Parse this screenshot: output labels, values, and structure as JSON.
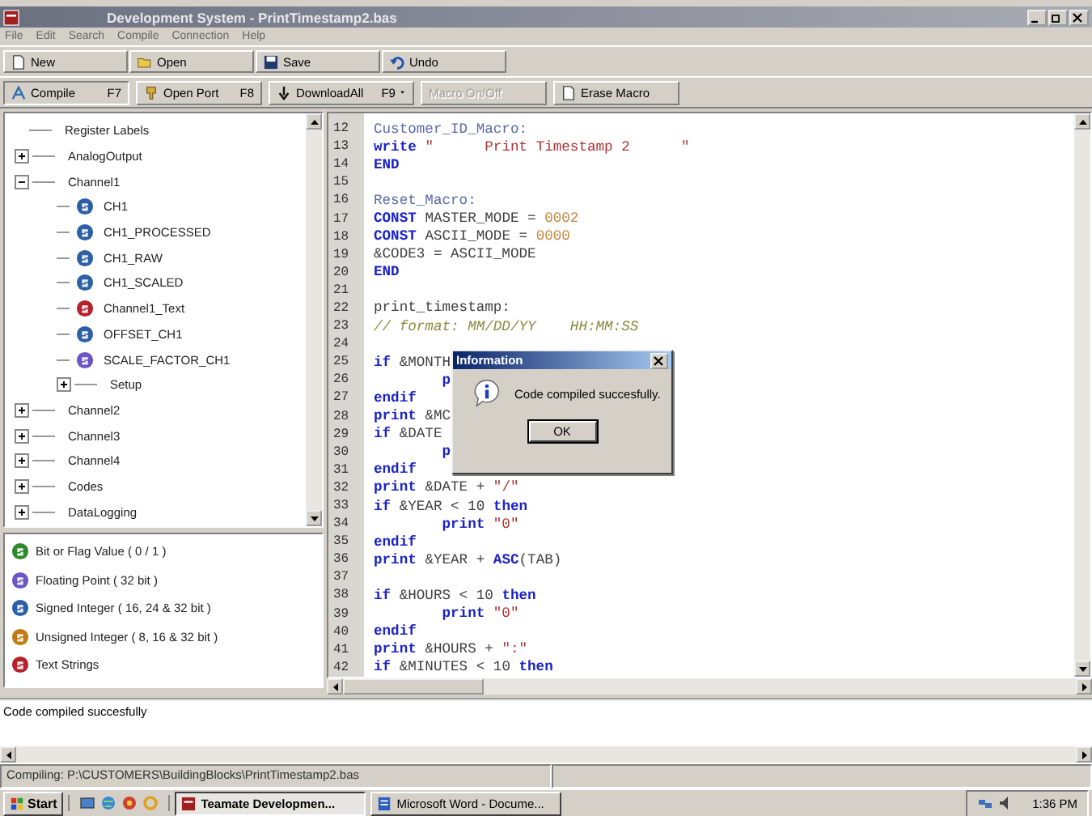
{
  "window": {
    "title": "Development System - PrintTimestamp2.bas"
  },
  "menu": [
    "File",
    "Edit",
    "Search",
    "Compile",
    "Connection",
    "Help"
  ],
  "toolbar": [
    {
      "label": "New",
      "kind": "new"
    },
    {
      "label": "Open",
      "kind": "open"
    },
    {
      "label": "Save",
      "kind": "save"
    },
    {
      "label": "Undo",
      "kind": "undo"
    }
  ],
  "toolbar2": [
    {
      "label": "Compile",
      "shortcut": "F7",
      "kind": "compile",
      "disabled": false,
      "dropdown": false
    },
    {
      "label": "Open Port",
      "shortcut": "F8",
      "kind": "port",
      "disabled": false,
      "dropdown": false
    },
    {
      "label": "DownloadAll",
      "shortcut": "F9",
      "kind": "download",
      "disabled": false,
      "dropdown": true
    },
    {
      "label": "Macro On/Off",
      "kind": "macro",
      "disabled": true,
      "dropdown": false
    },
    {
      "label": "Erase Macro",
      "kind": "erase",
      "disabled": false,
      "dropdown": false
    }
  ],
  "tree": [
    {
      "label": "Register Labels"
    },
    {
      "label": "AnalogOutput",
      "expanded": false
    },
    {
      "label": "Channel1",
      "expanded": true,
      "children": [
        {
          "label": "CH1",
          "kind": "signed"
        },
        {
          "label": "CH1_PROCESSED",
          "kind": "signed"
        },
        {
          "label": "CH1_RAW",
          "kind": "signed"
        },
        {
          "label": "CH1_SCALED",
          "kind": "signed"
        },
        {
          "label": "Channel1_Text",
          "kind": "text"
        },
        {
          "label": "OFFSET_CH1",
          "kind": "signed"
        },
        {
          "label": "SCALE_FACTOR_CH1",
          "kind": "float"
        },
        {
          "label": "Setup",
          "expanded": false
        }
      ]
    },
    {
      "label": "Channel2",
      "expanded": false
    },
    {
      "label": "Channel3",
      "expanded": false
    },
    {
      "label": "Channel4",
      "expanded": false
    },
    {
      "label": "Codes",
      "expanded": false
    },
    {
      "label": "DataLogging",
      "expanded": false
    }
  ],
  "legend": [
    {
      "label": "Bit or Flag Value ( 0 / 1 )",
      "kind": "bit"
    },
    {
      "label": "Floating Point ( 32 bit )",
      "kind": "float"
    },
    {
      "label": "Signed Integer ( 16, 24 & 32 bit )",
      "kind": "signed"
    },
    {
      "label": "Unsigned Integer ( 8, 16 & 32 bit )",
      "kind": "unsigned"
    },
    {
      "label": "Text Strings",
      "kind": "text"
    }
  ],
  "editor": {
    "lines": [
      {
        "number": "12",
        "segments": [
          {
            "text": "Customer_ID_Macro:",
            "kind": "label"
          }
        ]
      },
      {
        "number": "13",
        "segments": [
          {
            "text": "write ",
            "kind": "keyword"
          },
          {
            "text": "\"      Print Timestamp 2      \"",
            "kind": "string"
          }
        ]
      },
      {
        "number": "14",
        "segments": [
          {
            "text": "END",
            "kind": "keyword"
          }
        ]
      },
      {
        "number": "15"
      },
      {
        "number": "16",
        "segments": [
          {
            "text": "Reset_Macro:",
            "kind": "label"
          }
        ]
      },
      {
        "number": "17",
        "segments": [
          {
            "text": "CONST ",
            "kind": "keyword"
          },
          {
            "text": "MASTER_MODE = ",
            "kind": "plain"
          },
          {
            "text": "0002",
            "kind": "number"
          }
        ]
      },
      {
        "number": "18",
        "segments": [
          {
            "text": "CONST ",
            "kind": "keyword"
          },
          {
            "text": "ASCII_MODE = ",
            "kind": "plain"
          },
          {
            "text": "0000",
            "kind": "number"
          }
        ]
      },
      {
        "number": "19",
        "segments": [
          {
            "text": "&CODE3 = ASCII_MODE",
            "kind": "plain"
          }
        ]
      },
      {
        "number": "20",
        "segments": [
          {
            "text": "END",
            "kind": "keyword"
          }
        ]
      },
      {
        "number": "21"
      },
      {
        "number": "22",
        "segments": [
          {
            "text": "print_timestamp:",
            "kind": "plain"
          }
        ]
      },
      {
        "number": "23",
        "segments": [
          {
            "text": "// format: MM/DD/YY    HH:MM:SS",
            "kind": "comment"
          }
        ]
      },
      {
        "number": "24"
      },
      {
        "number": "25",
        "segments": [
          {
            "text": "if ",
            "kind": "keyword"
          },
          {
            "text": "&MONTH",
            "kind": "plain"
          }
        ]
      },
      {
        "number": "26",
        "segments": [
          {
            "text": "        p",
            "kind": "keyword"
          }
        ]
      },
      {
        "number": "27",
        "segments": [
          {
            "text": "endif",
            "kind": "keyword"
          }
        ]
      },
      {
        "number": "28",
        "segments": [
          {
            "text": "print ",
            "kind": "keyword"
          },
          {
            "text": "&MC",
            "kind": "plain"
          }
        ]
      },
      {
        "number": "29",
        "segments": [
          {
            "text": "if ",
            "kind": "keyword"
          },
          {
            "text": "&DATE",
            "kind": "plain"
          }
        ]
      },
      {
        "number": "30",
        "segments": [
          {
            "text": "        p",
            "kind": "keyword"
          }
        ]
      },
      {
        "number": "31",
        "segments": [
          {
            "text": "endif",
            "kind": "keyword"
          }
        ]
      },
      {
        "number": "32",
        "segments": [
          {
            "text": "print ",
            "kind": "keyword"
          },
          {
            "text": "&DATE + ",
            "kind": "plain"
          },
          {
            "text": "\"/\"",
            "kind": "string"
          }
        ]
      },
      {
        "number": "33",
        "segments": [
          {
            "text": "if ",
            "kind": "keyword"
          },
          {
            "text": "&YEAR < 10 ",
            "kind": "plain"
          },
          {
            "text": "then",
            "kind": "keyword"
          }
        ]
      },
      {
        "number": "34",
        "segments": [
          {
            "text": "        print ",
            "kind": "keyword"
          },
          {
            "text": "\"0\"",
            "kind": "string"
          }
        ]
      },
      {
        "number": "35",
        "segments": [
          {
            "text": "endif",
            "kind": "keyword"
          }
        ]
      },
      {
        "number": "36",
        "segments": [
          {
            "text": "print ",
            "kind": "keyword"
          },
          {
            "text": "&YEAR + ",
            "kind": "plain"
          },
          {
            "text": "ASC",
            "kind": "keyword"
          },
          {
            "text": "(TAB)",
            "kind": "plain"
          }
        ]
      },
      {
        "number": "37"
      },
      {
        "number": "38",
        "segments": [
          {
            "text": "if ",
            "kind": "keyword"
          },
          {
            "text": "&HOURS < 10 ",
            "kind": "plain"
          },
          {
            "text": "then",
            "kind": "keyword"
          }
        ]
      },
      {
        "number": "39",
        "segments": [
          {
            "text": "        print ",
            "kind": "keyword"
          },
          {
            "text": "\"0\"",
            "kind": "string"
          }
        ]
      },
      {
        "number": "40",
        "segments": [
          {
            "text": "endif",
            "kind": "keyword"
          }
        ]
      },
      {
        "number": "41",
        "segments": [
          {
            "text": "print ",
            "kind": "keyword"
          },
          {
            "text": "&HOURS + ",
            "kind": "plain"
          },
          {
            "text": "\":\"",
            "kind": "string"
          }
        ]
      },
      {
        "number": "42",
        "segments": [
          {
            "text": "if ",
            "kind": "keyword"
          },
          {
            "text": "&MINUTES < 10 ",
            "kind": "plain"
          },
          {
            "text": "then",
            "kind": "keyword"
          }
        ]
      }
    ]
  },
  "dialog": {
    "title": "Information",
    "message": "Code compiled succesfully.",
    "button": "OK"
  },
  "output": {
    "text": "Code compiled succesfully"
  },
  "status_bar": {
    "text": "Compiling: P:\\CUSTOMERS\\BuildingBlocks\\PrintTimestamp2.bas"
  },
  "taskbar": {
    "start": "Start",
    "tasks": [
      {
        "label": "Teamate Developmen...",
        "selected": true,
        "kind": "app"
      },
      {
        "label": "Microsoft Word - Docume...",
        "selected": false,
        "kind": "word"
      }
    ],
    "clock": "1:36 PM"
  }
}
